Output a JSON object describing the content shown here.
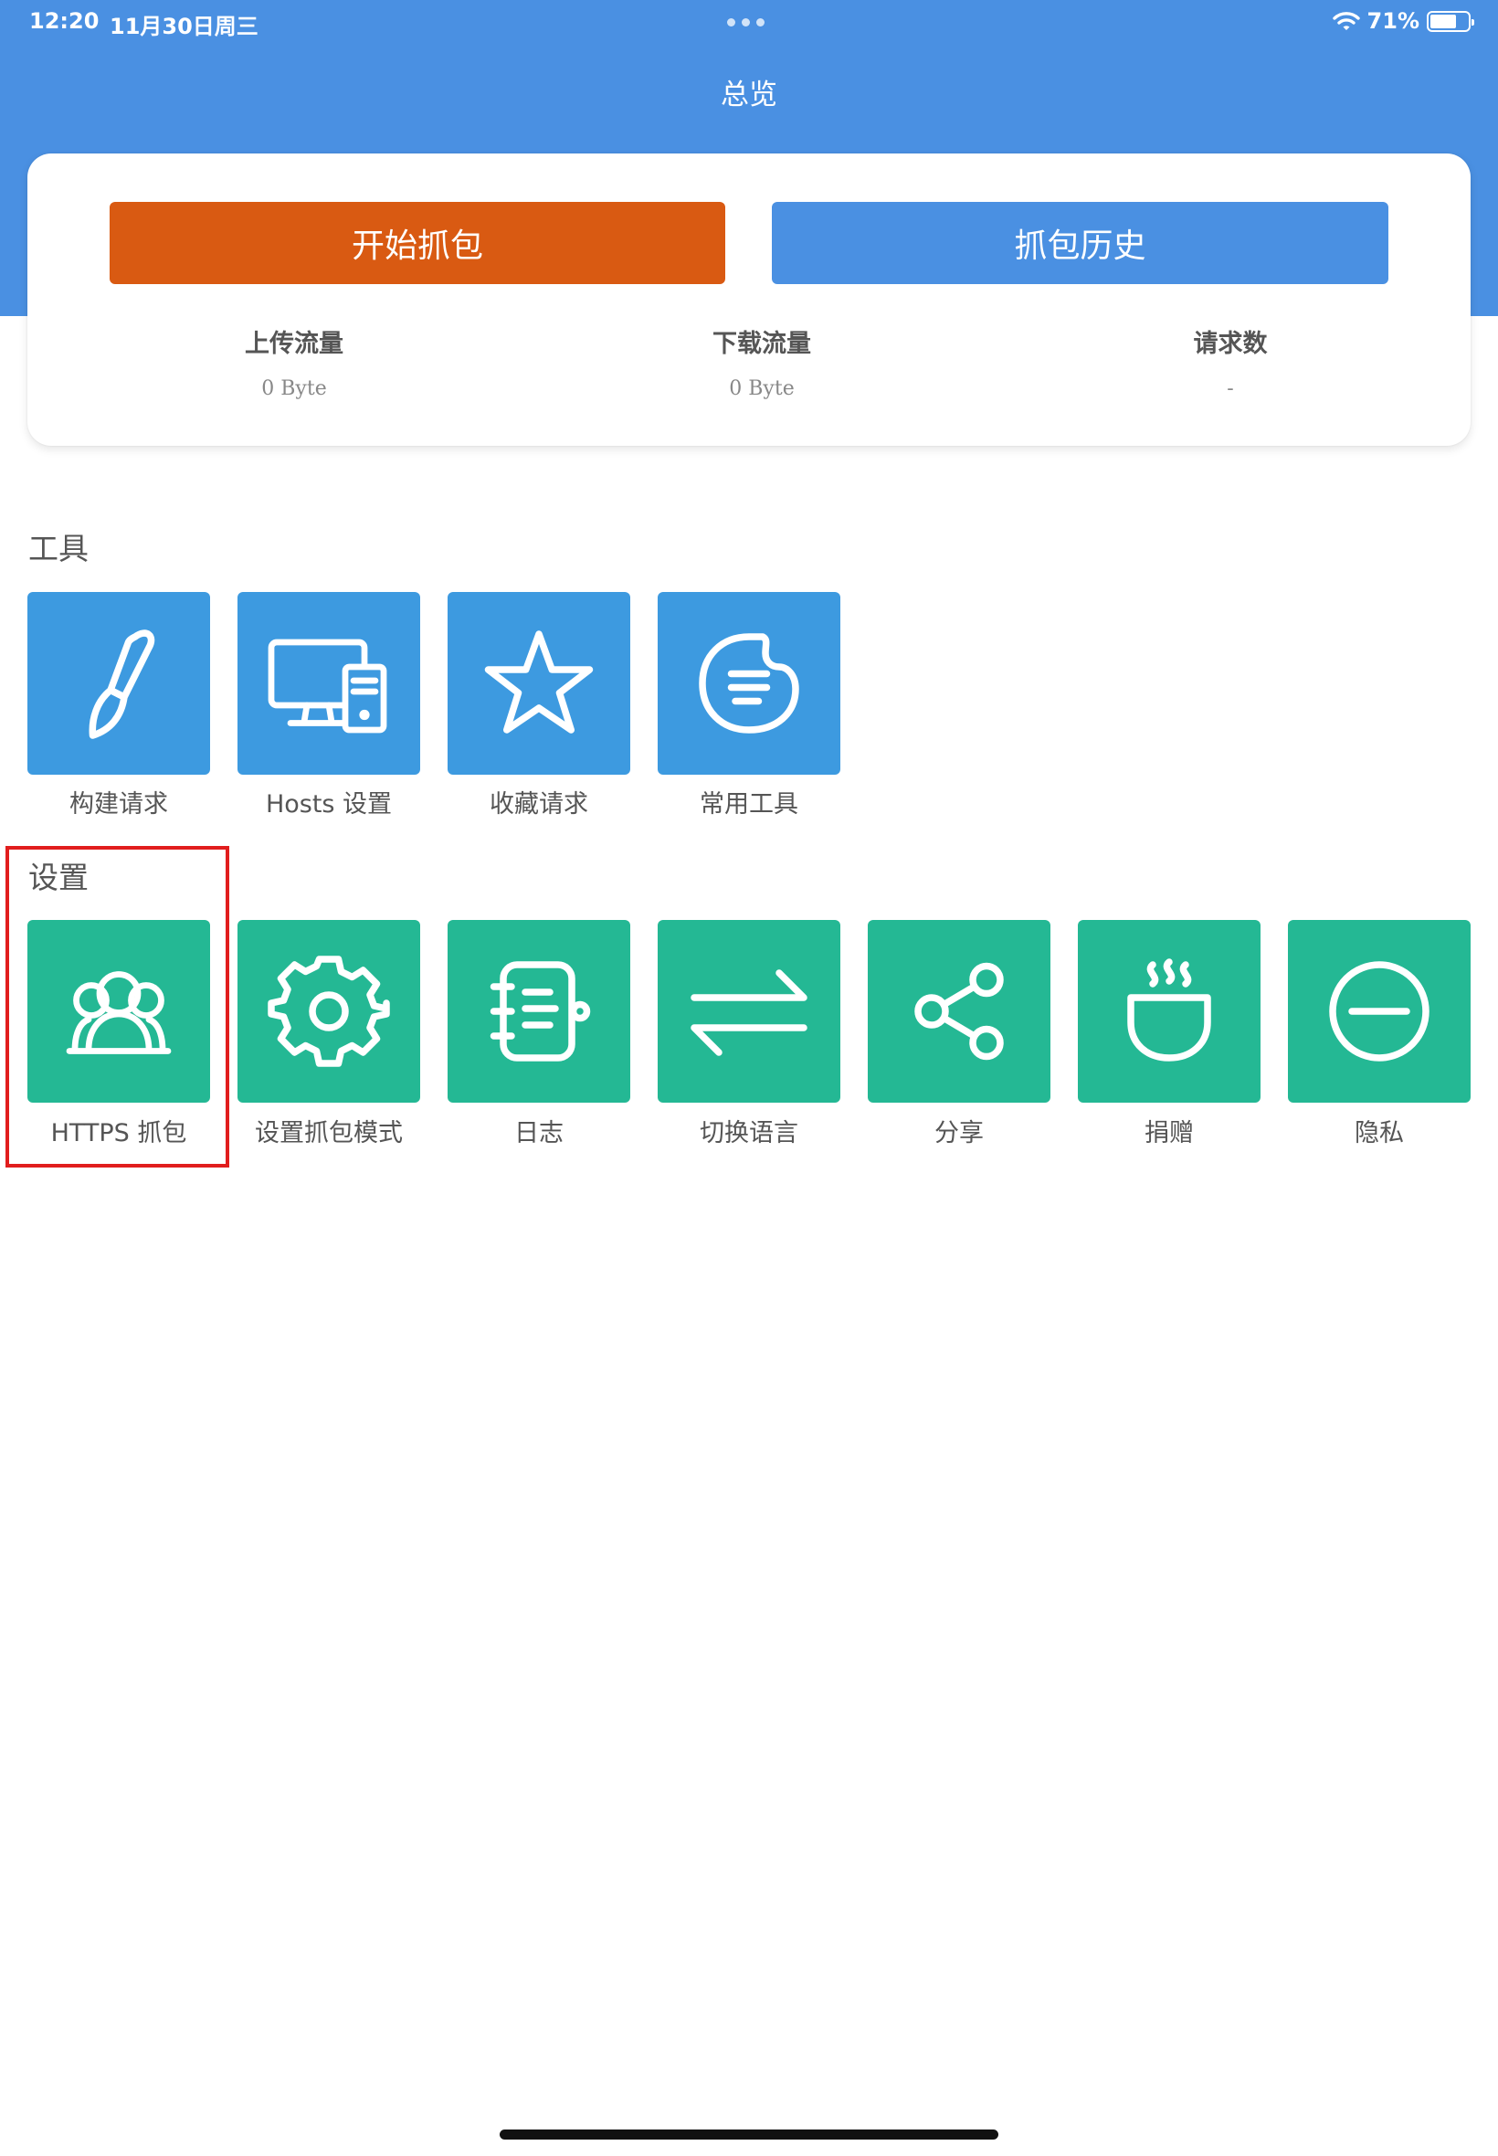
{
  "status_bar": {
    "time": "12:20",
    "date": "11月30日周三",
    "battery": "71%",
    "battery_level": 0.71,
    "wifi_icon": "wifi-icon",
    "battery_icon": "battery-icon"
  },
  "header": {
    "title": "总览",
    "background": "#4a90e2"
  },
  "actions": {
    "start_label": "开始抓包",
    "start_color": "#d95a12",
    "history_label": "抓包历史",
    "history_color": "#4a90e2"
  },
  "stats": [
    {
      "label": "上传流量",
      "value": "0 Byte"
    },
    {
      "label": "下载流量",
      "value": "0 Byte"
    },
    {
      "label": "请求数",
      "value": "-"
    }
  ],
  "tools": {
    "title": "工具",
    "color": "#3d9ae0",
    "items": [
      {
        "label": "构建请求",
        "icon": "brush-icon"
      },
      {
        "label": "Hosts 设置",
        "icon": "computer-icon"
      },
      {
        "label": "收藏请求",
        "icon": "star-icon"
      },
      {
        "label": "常用工具",
        "icon": "palette-icon"
      }
    ]
  },
  "settings": {
    "title": "设置",
    "color": "#24b894",
    "items": [
      {
        "label": "HTTPS 抓包",
        "icon": "users-icon"
      },
      {
        "label": "设置抓包模式",
        "icon": "gear-icon"
      },
      {
        "label": "日志",
        "icon": "notebook-icon"
      },
      {
        "label": "切换语言",
        "icon": "switch-arrows-icon"
      },
      {
        "label": "分享",
        "icon": "share-icon"
      },
      {
        "label": "捐赠",
        "icon": "coffee-bowl-icon"
      },
      {
        "label": "隐私",
        "icon": "minus-circle-icon"
      }
    ]
  },
  "highlight_color": "#e11d1d"
}
